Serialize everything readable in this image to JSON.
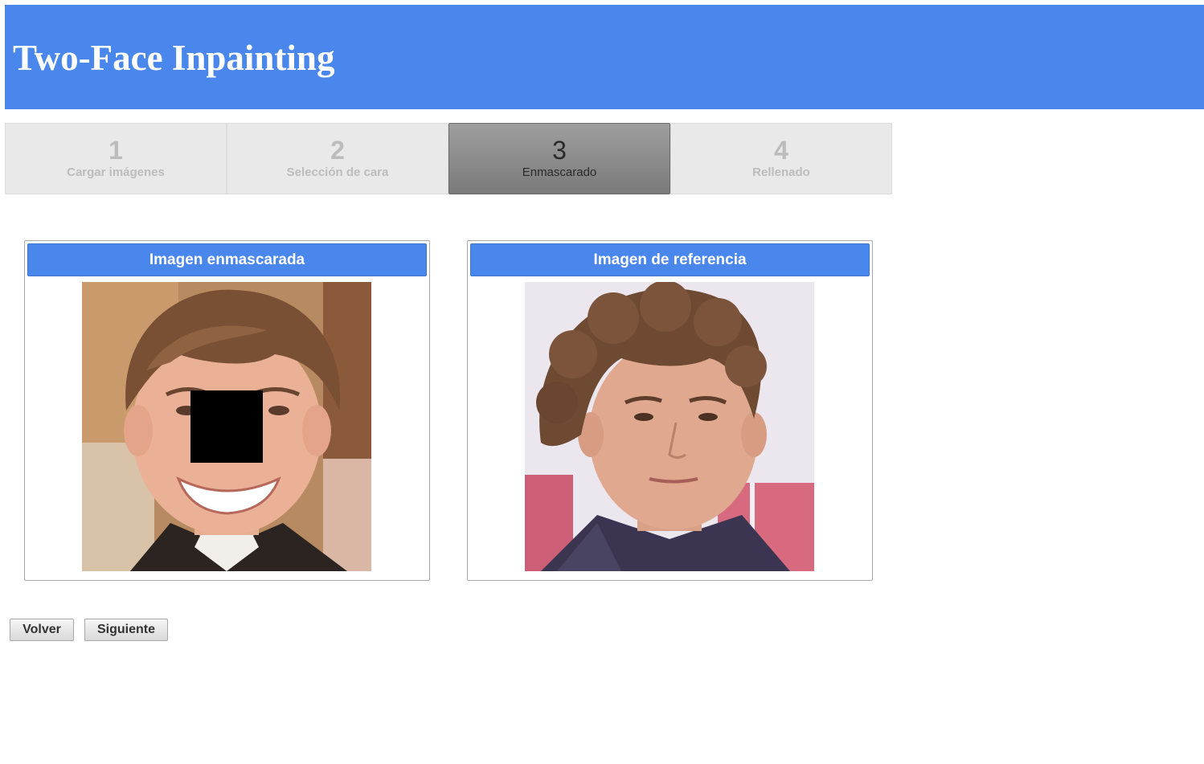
{
  "header": {
    "title": "Two-Face Inpainting",
    "color": "#4a87ec"
  },
  "steps": [
    {
      "number": "1",
      "label": "Cargar imágenes",
      "state": "disabled"
    },
    {
      "number": "2",
      "label": "Selección de cara",
      "state": "disabled"
    },
    {
      "number": "3",
      "label": "Enmascarado",
      "state": "active"
    },
    {
      "number": "4",
      "label": "Rellenado",
      "state": "disabled"
    }
  ],
  "panels": {
    "masked": {
      "title": "Imagen enmascarada"
    },
    "reference": {
      "title": "Imagen de referencia"
    }
  },
  "buttons": {
    "back_label": "Volver",
    "next_label": "Siguiente"
  }
}
